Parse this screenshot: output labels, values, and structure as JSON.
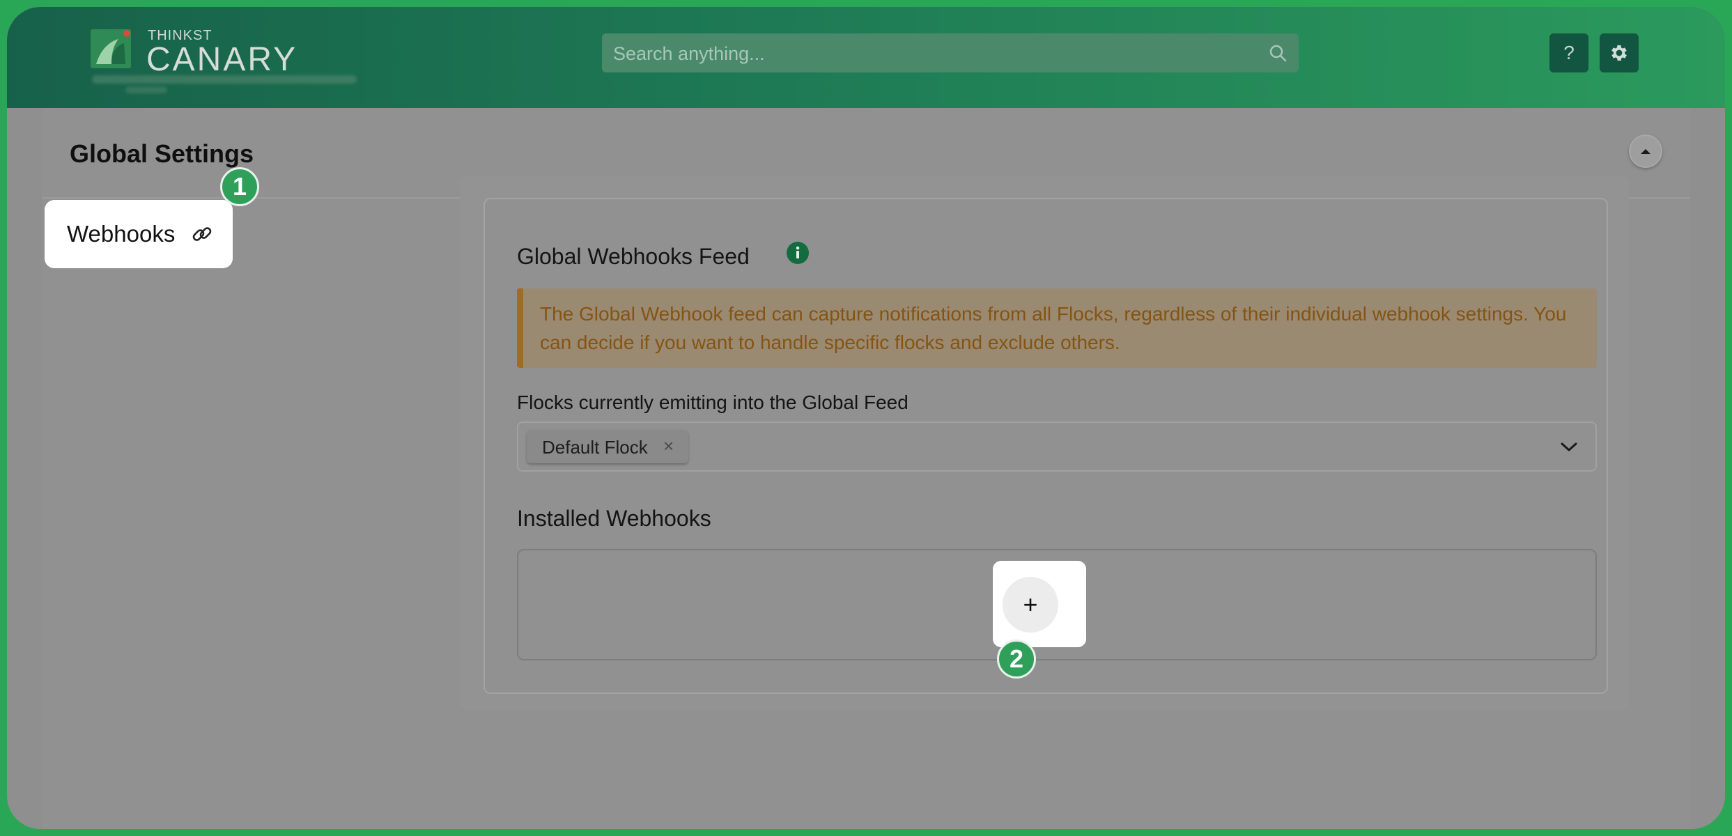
{
  "header": {
    "logo_small": "THINKST",
    "logo_big": "CANARY",
    "search_placeholder": "Search anything...",
    "help_label": "?",
    "colors": {
      "header_start": "#17614a",
      "header_end": "#2b9a5c",
      "accent": "#2ea05a"
    }
  },
  "settings": {
    "title": "Global Settings",
    "tab_label": "Webhooks"
  },
  "feed": {
    "title": "Global Webhooks Feed",
    "alert_text": "The Global Webhook feed can capture notifications from all Flocks, regardless of their individual webhook settings. You can decide if you want to handle specific flocks and exclude others.",
    "flocks_label": "Flocks currently emitting into the Global Feed",
    "selected_flock": "Default Flock",
    "chip_remove": "×",
    "installed_label": "Installed Webhooks",
    "add_label": "+"
  },
  "badges": [
    "1",
    "2"
  ]
}
